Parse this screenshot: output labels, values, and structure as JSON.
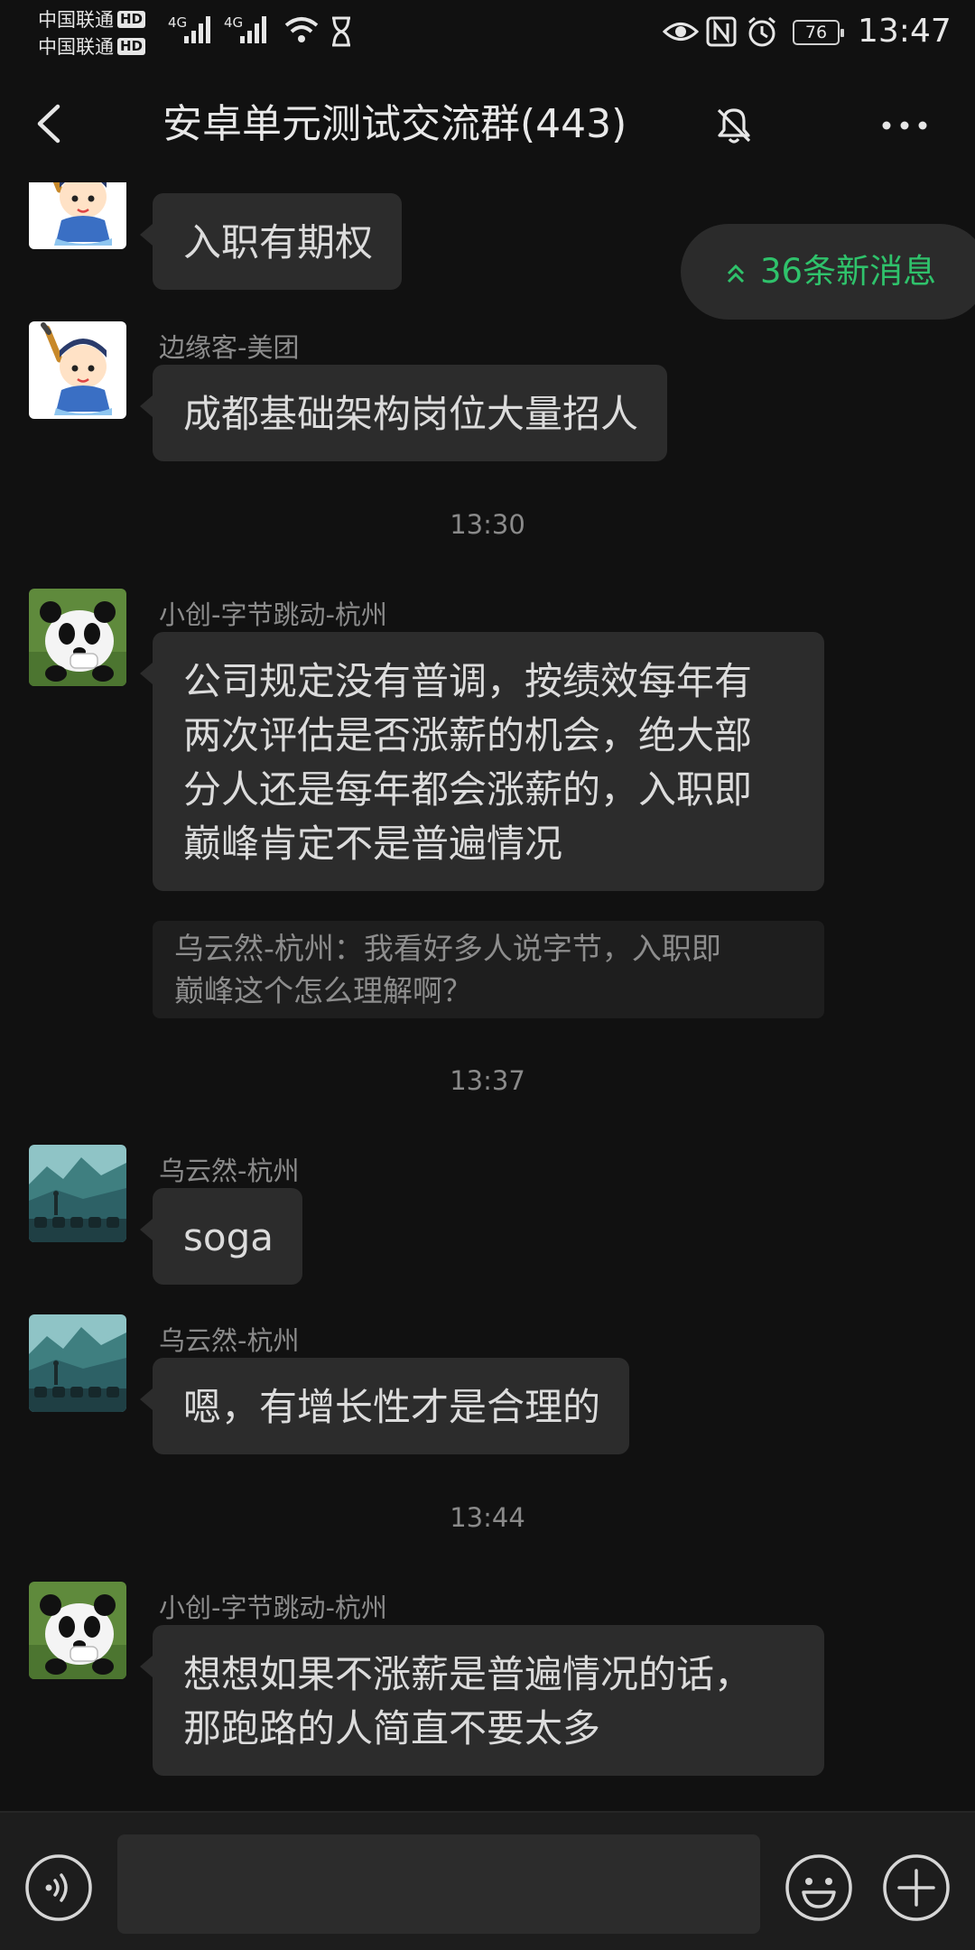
{
  "status_bar": {
    "carrier1": "中国联通",
    "carrier2": "中国联通",
    "hd": "HD",
    "net1": "4G",
    "net2": "4G",
    "battery": "76",
    "time": "13:47"
  },
  "header": {
    "title": "安卓单元测试交流群(443)",
    "back_icon": "back-chevron-icon",
    "mute_icon": "bell-off-icon",
    "more_icon": "more-dots-icon"
  },
  "new_messages": {
    "label": "36条新消息",
    "color": "#2fc26b"
  },
  "messages": [
    {
      "sender": "",
      "text": "入职有期权",
      "avatar": "cartoon-painter-avatar"
    },
    {
      "sender": "边缘客-美团",
      "text": "成都基础架构岗位大量招人",
      "avatar": "cartoon-painter-avatar"
    },
    {
      "time": "13:30"
    },
    {
      "sender": "小创-字节跳动-杭州",
      "lines": [
        "公司规定没有普调，按绩效每年有",
        "两次评估是否涨薪的机会，绝大部",
        "分人还是每年都会涨薪的，入职即",
        "巅峰肯定不是普遍情况"
      ],
      "quote_lines": [
        "乌云然-杭州：我看好多人说字节，入职即",
        "巅峰这个怎么理解啊？"
      ],
      "avatar": "panda-avatar"
    },
    {
      "time": "13:37"
    },
    {
      "sender": "乌云然-杭州",
      "text": "soga",
      "avatar": "landscape-avatar"
    },
    {
      "sender": "乌云然-杭州",
      "text": "嗯，有增长性才是合理的",
      "avatar": "landscape-avatar"
    },
    {
      "time": "13:44"
    },
    {
      "sender": "小创-字节跳动-杭州",
      "lines": [
        "想想如果不涨薪是普遍情况的话，",
        "那跑路的人简直不要太多"
      ],
      "avatar": "panda-avatar"
    }
  ],
  "input_bar": {
    "placeholder": "",
    "voice_icon": "voice-icon",
    "emoji_icon": "emoji-icon",
    "plus_icon": "plus-icon"
  },
  "colors": {
    "background": "#111111",
    "bubble": "#2c2c2c",
    "accent_green": "#2fc26b"
  }
}
